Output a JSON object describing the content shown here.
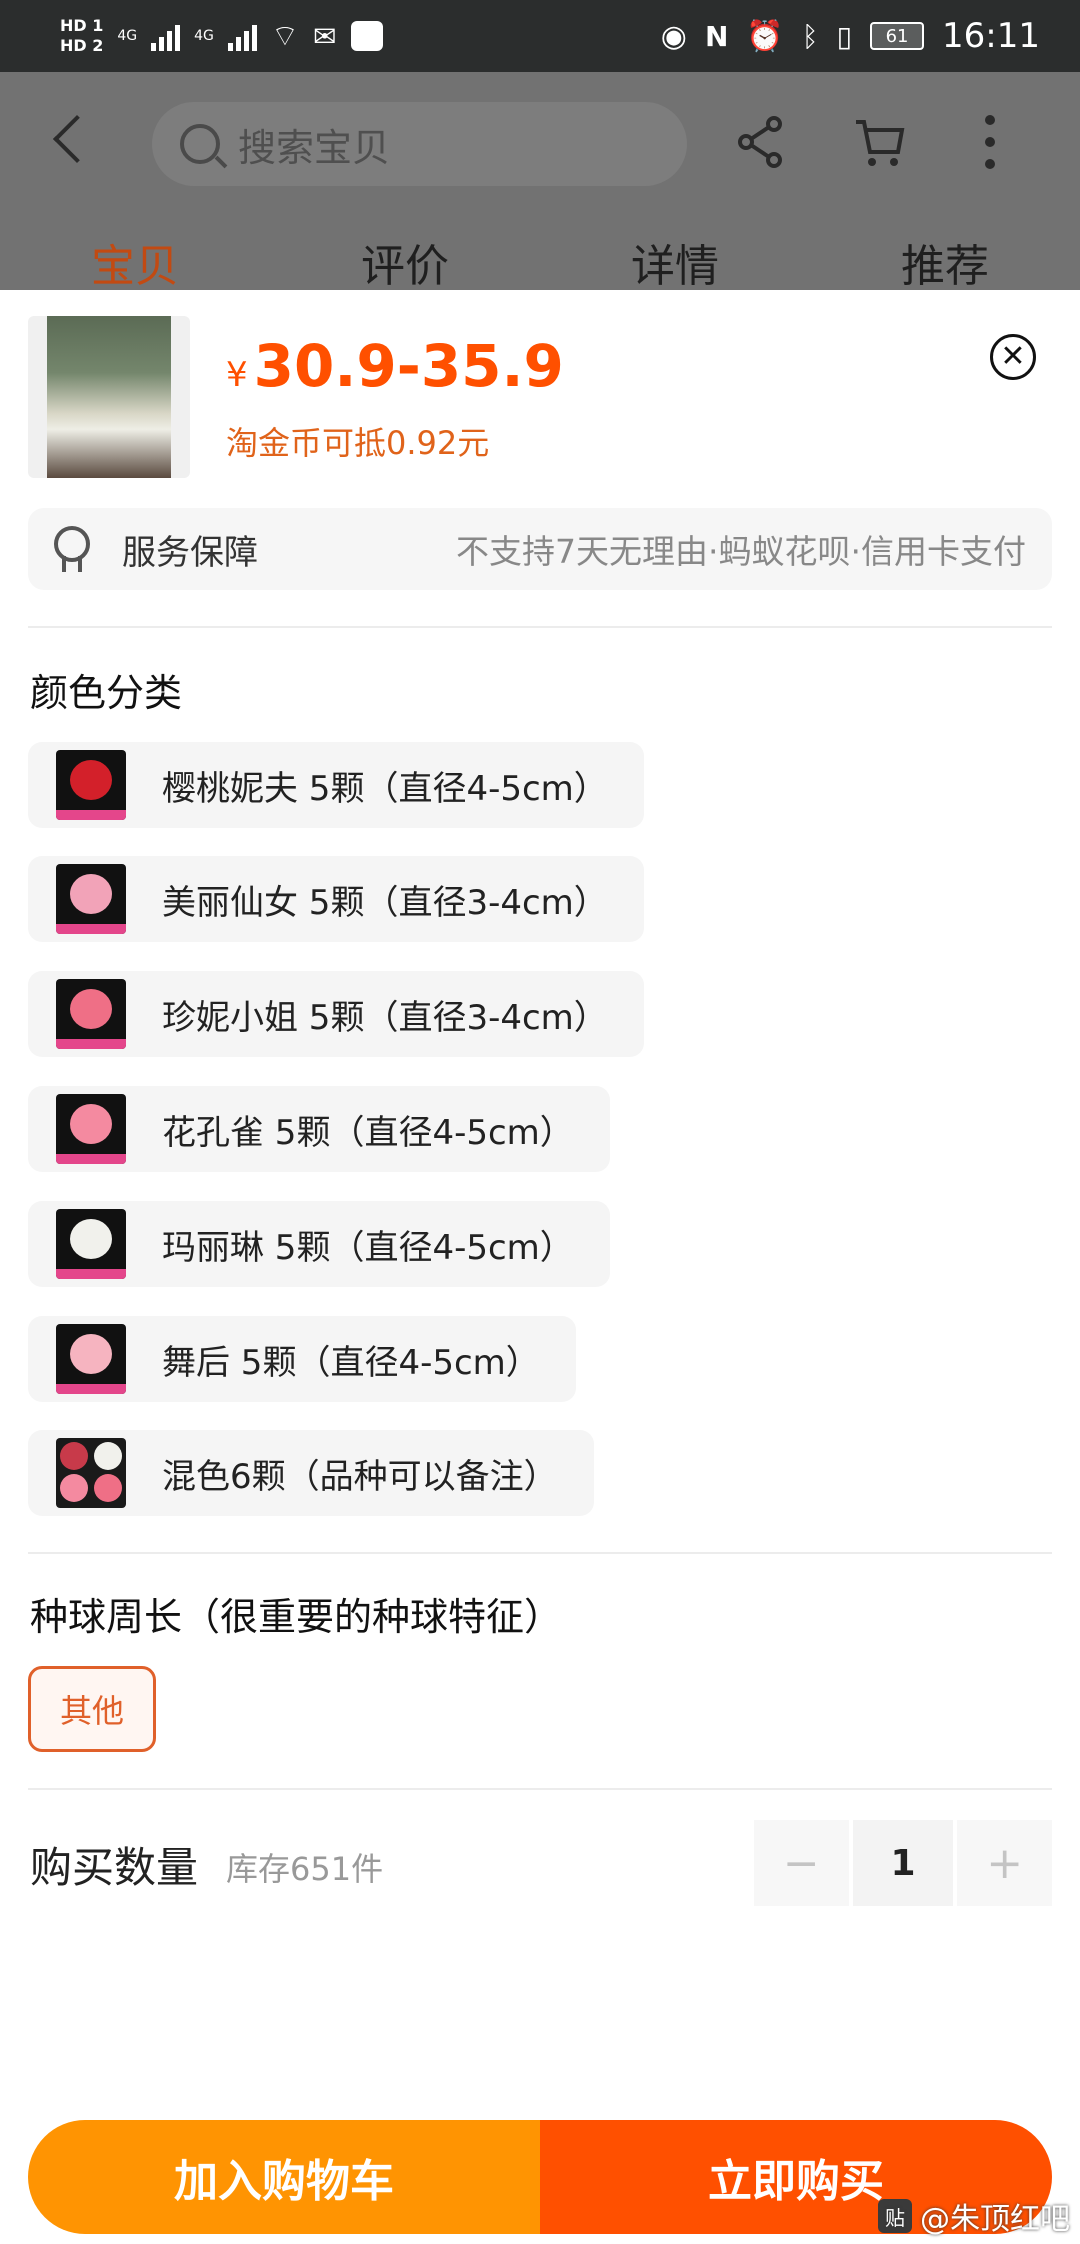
{
  "status_bar": {
    "hd1": "HD 1",
    "hd2": "HD 2",
    "net1": "4G",
    "net2": "4G",
    "battery": "61",
    "time": "16:11"
  },
  "header": {
    "search_placeholder": "搜索宝贝",
    "tabs": [
      {
        "label": "宝贝",
        "active": true
      },
      {
        "label": "评价",
        "active": false
      },
      {
        "label": "详情",
        "active": false
      },
      {
        "label": "推荐",
        "active": false
      }
    ]
  },
  "product": {
    "currency_symbol": "¥",
    "price_range": "30.9-35.9",
    "coin_deduction": "淘金币可抵0.92元"
  },
  "service": {
    "label": "服务保障",
    "value": "不支持7天无理由·蚂蚁花呗·信用卡支付"
  },
  "color_section": {
    "title": "颜色分类",
    "options": [
      {
        "label": "樱桃妮夫 5颗（直径4-5cm）",
        "bloom_color": "#d3202a"
      },
      {
        "label": "美丽仙女 5颗（直径3-4cm）",
        "bloom_color": "#f2a3b8"
      },
      {
        "label": "珍妮小姐 5颗（直径3-4cm）",
        "bloom_color": "#ef6f86"
      },
      {
        "label": "花孔雀 5颗（直径4-5cm）",
        "bloom_color": "#f48aa0"
      },
      {
        "label": "玛丽琳 5颗（直径4-5cm）",
        "bloom_color": "#f1f1ec"
      },
      {
        "label": "舞后 5颗（直径4-5cm）",
        "bloom_color": "#f6b4c0"
      },
      {
        "label": "混色6颗（品种可以备注）",
        "bloom_color": "#c83a4a"
      }
    ]
  },
  "size_section": {
    "title": "种球周长（很重要的种球特征）",
    "options": [
      {
        "label": "其他",
        "selected": true
      }
    ]
  },
  "quantity": {
    "label": "购买数量",
    "stock": "库存651件",
    "minus": "−",
    "value": "1",
    "plus": "+"
  },
  "actions": {
    "add_to_cart": "加入购物车",
    "buy_now": "立即购买"
  },
  "watermark": {
    "badge": "贴",
    "text": "@朱顶红吧"
  },
  "colors": {
    "accent": "#ff5000",
    "cart_button": "#ff9402",
    "selected_chip": "#e0602a"
  }
}
